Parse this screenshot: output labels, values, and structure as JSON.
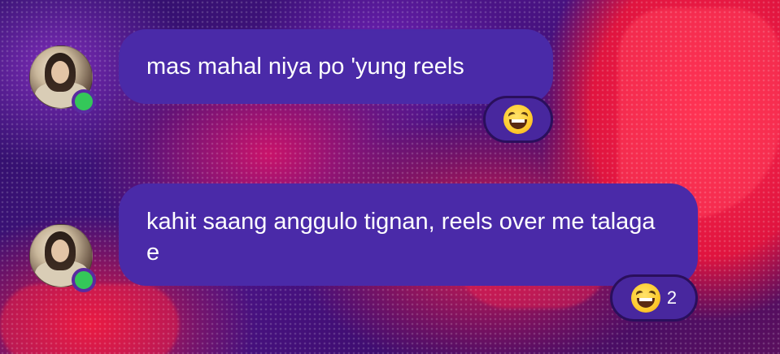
{
  "messages": [
    {
      "text": "mas mahal niya po 'yung reels",
      "reaction": {
        "emoji": "grinning-squinting-face",
        "count": ""
      }
    },
    {
      "text": "kahit saang anggulo tignan, reels over me talaga e",
      "reaction": {
        "emoji": "grinning-squinting-face",
        "count": "2"
      }
    }
  ],
  "colors": {
    "bubble": "#4a2aa8",
    "reaction_bg": "#48279e",
    "online": "#34c759"
  }
}
